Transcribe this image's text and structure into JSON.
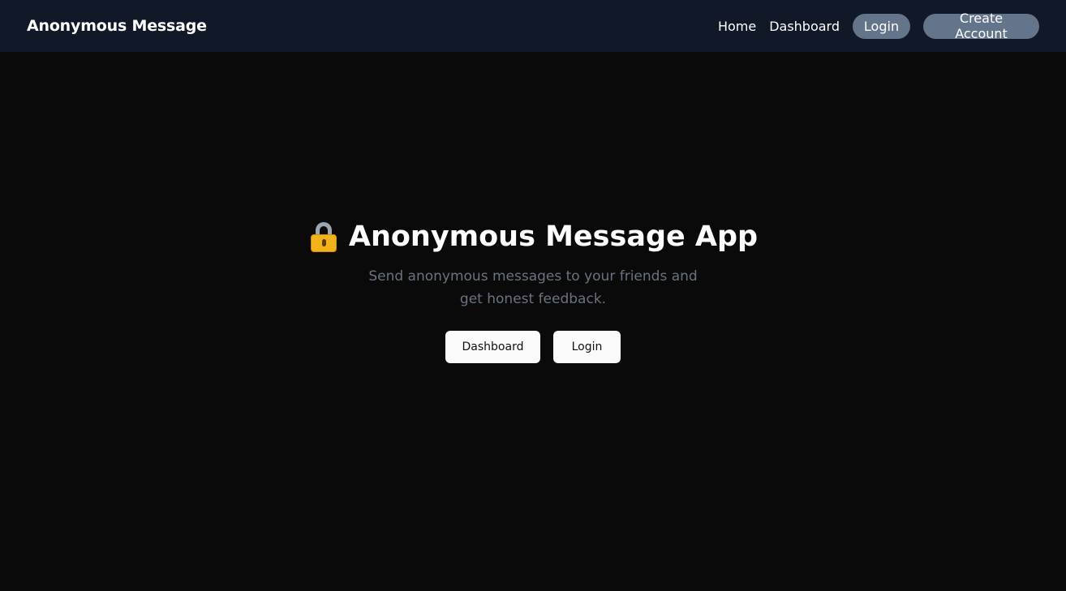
{
  "navbar": {
    "brand": "Anonymous Message",
    "links": {
      "home": "Home",
      "dashboard": "Dashboard"
    },
    "login_label": "Login",
    "create_account_label": "Create Account",
    "background_color": "#111827",
    "pill_color": "#64748b"
  },
  "hero": {
    "icon": "lock-icon",
    "title": "Anonymous Message App",
    "subtitle": "Send anonymous messages to your friends and get honest feedback.",
    "buttons": {
      "dashboard": "Dashboard",
      "login": "Login"
    }
  },
  "colors": {
    "page_background": "#0a0a0a",
    "subtitle_text": "#6b7280",
    "hero_button_background": "#fafafa"
  }
}
